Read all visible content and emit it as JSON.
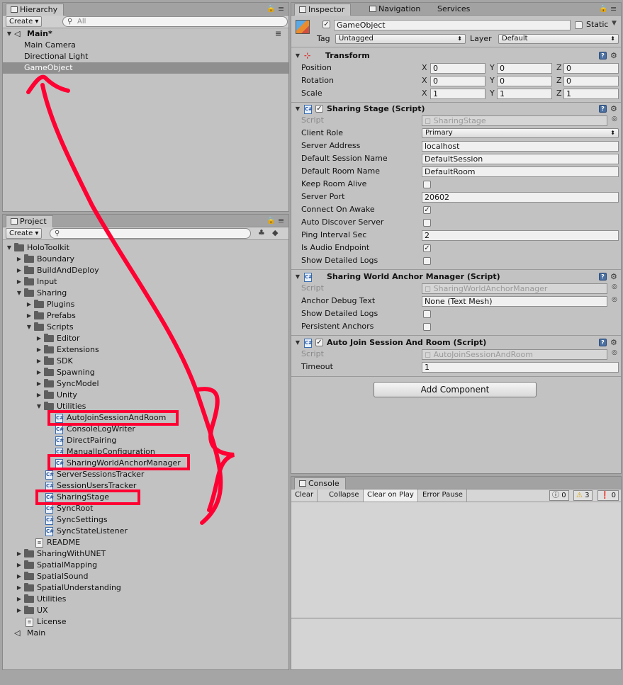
{
  "hierarchy": {
    "tab": "Hierarchy",
    "create": "Create",
    "search_placeholder": "All",
    "scene": "Main*",
    "items": [
      "Main Camera",
      "Directional Light",
      "GameObject"
    ]
  },
  "project": {
    "tab": "Project",
    "create": "Create",
    "tree": [
      "HoloToolkit",
      "Boundary",
      "BuildAndDeploy",
      "Input",
      "Sharing",
      "Plugins",
      "Prefabs",
      "Scripts",
      "Editor",
      "Extensions",
      "SDK",
      "Spawning",
      "SyncModel",
      "Unity",
      "Utilities",
      "AutoJoinSessionAndRoom",
      "ConsoleLogWriter",
      "DirectPairing",
      "ManualIpConfiguration",
      "SharingWorldAnchorManager",
      "ServerSessionsTracker",
      "SessionUsersTracker",
      "SharingStage",
      "SyncRoot",
      "SyncSettings",
      "SyncStateListener",
      "README",
      "SharingWithUNET",
      "SpatialMapping",
      "SpatialSound",
      "SpatialUnderstanding",
      "Utilities",
      "UX",
      "License",
      "Main"
    ]
  },
  "inspector": {
    "tabs": [
      "Inspector",
      "Navigation",
      "Services"
    ],
    "object_name": "GameObject",
    "static_label": "Static",
    "tag_label": "Tag",
    "tag_value": "Untagged",
    "layer_label": "Layer",
    "layer_value": "Default",
    "transform": {
      "title": "Transform",
      "axes": [
        "X",
        "Y",
        "Z"
      ],
      "rows": [
        {
          "label": "Position",
          "values": [
            "0",
            "0",
            "0"
          ]
        },
        {
          "label": "Rotation",
          "values": [
            "0",
            "0",
            "0"
          ]
        },
        {
          "label": "Scale",
          "values": [
            "1",
            "1",
            "1"
          ]
        }
      ]
    },
    "sharing_stage": {
      "title": "Sharing Stage (Script)",
      "script_label": "Script",
      "script_value": "SharingStage",
      "client_role_label": "Client Role",
      "client_role_value": "Primary",
      "server_address_label": "Server Address",
      "server_address_value": "localhost",
      "default_session_label": "Default Session Name",
      "default_session_value": "DefaultSession",
      "default_room_label": "Default Room Name",
      "default_room_value": "DefaultRoom",
      "keep_room_alive_label": "Keep Room Alive",
      "server_port_label": "Server Port",
      "server_port_value": "20602",
      "connect_on_awake_label": "Connect On Awake",
      "auto_discover_label": "Auto Discover Server",
      "ping_interval_label": "Ping Interval Sec",
      "ping_interval_value": "2",
      "is_audio_endpoint_label": "Is Audio Endpoint",
      "show_detailed_logs_label": "Show Detailed Logs"
    },
    "anchor_manager": {
      "title": "Sharing World Anchor Manager (Script)",
      "script_label": "Script",
      "script_value": "SharingWorldAnchorManager",
      "anchor_debug_label": "Anchor Debug Text",
      "anchor_debug_value": "None (Text Mesh)",
      "show_detailed_logs_label": "Show Detailed Logs",
      "persistent_anchors_label": "Persistent Anchors"
    },
    "auto_join": {
      "title": "Auto Join Session And Room (Script)",
      "script_label": "Script",
      "script_value": "AutoJoinSessionAndRoom",
      "timeout_label": "Timeout",
      "timeout_value": "1"
    },
    "add_component": "Add Component"
  },
  "console": {
    "tab": "Console",
    "buttons": [
      "Clear",
      "Collapse",
      "Clear on Play",
      "Error Pause"
    ],
    "counts": {
      "logs": "0",
      "warnings": "3",
      "errors": "0"
    }
  }
}
